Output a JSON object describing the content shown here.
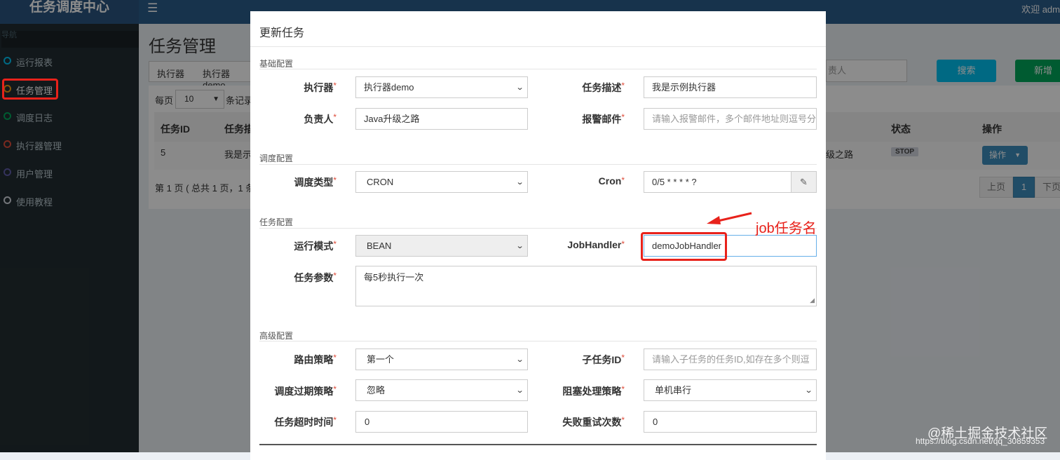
{
  "app": {
    "title": "任务调度中心",
    "welcome": "欢迎 adm"
  },
  "sidebar": {
    "header": "导航",
    "items": [
      {
        "label": "运行报表",
        "color": "#00c0ef"
      },
      {
        "label": "任务管理",
        "color": "#f39c12"
      },
      {
        "label": "调度日志",
        "color": "#00a65a"
      },
      {
        "label": "执行器管理",
        "color": "#dd4b39"
      },
      {
        "label": "用户管理",
        "color": "#605ca8"
      },
      {
        "label": "使用教程",
        "color": "#d2d6de"
      }
    ]
  },
  "page": {
    "title": "任务管理",
    "filter_label": "执行器",
    "filter_value": "执行器demo",
    "search_placeholder": "责人",
    "search_button": "搜索",
    "add_button": "新增",
    "per_page_prefix": "每页",
    "per_page_value": "10",
    "per_page_suffix": "条记录",
    "table": {
      "headers": [
        "任务ID",
        "任务描",
        "状态",
        "操作"
      ],
      "row": {
        "id": "5",
        "desc": "我是示",
        "owner": "级之路",
        "status": "STOP",
        "action": "操作"
      }
    },
    "pager_info": "第 1 页 ( 总共 1 页，1 条",
    "pager": {
      "prev": "上页",
      "current": "1",
      "next": "下页"
    }
  },
  "modal": {
    "title": "更新任务",
    "sections": {
      "basic": "基础配置",
      "schedule": "调度配置",
      "task": "任务配置",
      "advanced": "高级配置"
    },
    "fields": {
      "executor": {
        "label": "执行器",
        "value": "执行器demo"
      },
      "job_desc": {
        "label": "任务描述",
        "value": "我是示例执行器"
      },
      "author": {
        "label": "负责人",
        "value": "Java升级之路"
      },
      "alarm_email": {
        "label": "报警邮件",
        "placeholder": "请输入报警邮件，多个邮件地址则逗号分"
      },
      "schedule_type": {
        "label": "调度类型",
        "value": "CRON"
      },
      "cron": {
        "label": "Cron",
        "value": "0/5 * * * * ?"
      },
      "glue_type": {
        "label": "运行模式",
        "value": "BEAN"
      },
      "job_handler": {
        "label": "JobHandler",
        "value": "demoJobHandler"
      },
      "job_param": {
        "label": "任务参数",
        "value": "每5秒执行一次"
      },
      "route_strategy": {
        "label": "路由策略",
        "value": "第一个"
      },
      "child_job": {
        "label": "子任务ID",
        "placeholder": "请输入子任务的任务ID,如存在多个则逗"
      },
      "misfire_strategy": {
        "label": "调度过期策略",
        "value": "忽略"
      },
      "block_strategy": {
        "label": "阻塞处理策略",
        "value": "单机串行"
      },
      "timeout": {
        "label": "任务超时时间",
        "value": "0"
      },
      "fail_retry": {
        "label": "失败重试次数",
        "value": "0"
      }
    },
    "required_mark": "*"
  },
  "annotation": {
    "text": "job任务名"
  },
  "watermark": {
    "line1": "@稀土掘金技术社区",
    "line2": "https://blog.csdn.net/qq_30859353"
  },
  "colors": {
    "topbar": "#2b5d8a",
    "sidebar": "#222d32",
    "highlight": "#e8221b",
    "primary": "#3c8dbc",
    "search": "#00c0ef",
    "add": "#00a65a"
  },
  "icons": {
    "menu": "hamburger-icon",
    "edit": "edit-icon",
    "chevron": "chevron-down-icon"
  }
}
